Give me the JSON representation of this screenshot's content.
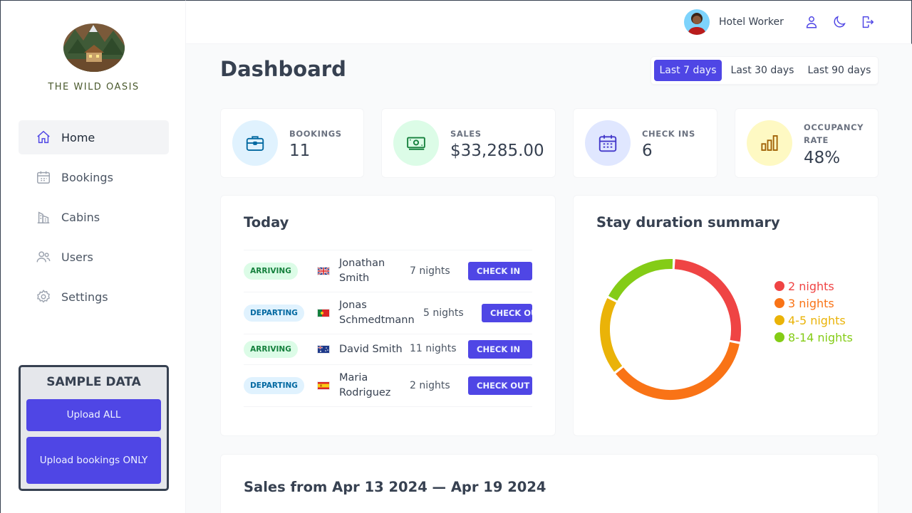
{
  "brand": {
    "name": "THE WILD OASIS"
  },
  "sidebar": {
    "items": [
      {
        "label": "Home",
        "icon": "home-icon",
        "active": true
      },
      {
        "label": "Bookings",
        "icon": "calendar-icon",
        "active": false
      },
      {
        "label": "Cabins",
        "icon": "buildings-icon",
        "active": false
      },
      {
        "label": "Users",
        "icon": "users-icon",
        "active": false
      },
      {
        "label": "Settings",
        "icon": "cog-icon",
        "active": false
      }
    ]
  },
  "sample_data": {
    "title": "SAMPLE DATA",
    "upload_all": "Upload ALL",
    "upload_bookings": "Upload bookings ONLY"
  },
  "header": {
    "user_name": "Hotel Worker",
    "icons": [
      "user-icon",
      "moon-icon",
      "logout-icon"
    ]
  },
  "page": {
    "title": "Dashboard"
  },
  "filter": {
    "options": [
      "Last 7 days",
      "Last 30 days",
      "Last 90 days"
    ],
    "selected": "Last 7 days"
  },
  "stats": [
    {
      "label": "BOOKINGS",
      "value": "11",
      "icon": "briefcase-icon",
      "bg": "#e0f2fe",
      "color": "#0369a1"
    },
    {
      "label": "SALES",
      "value": "$33,285.00",
      "icon": "banknotes-icon",
      "bg": "#dcfce7",
      "color": "#15803d"
    },
    {
      "label": "CHECK INS",
      "value": "6",
      "icon": "calendar-days-icon",
      "bg": "#e0e7ff",
      "color": "#4338ca"
    },
    {
      "label": "OCCUPANCY RATE",
      "value": "48%",
      "icon": "chart-bar-icon",
      "bg": "#fef9c3",
      "color": "#a16207"
    }
  ],
  "today": {
    "title": "Today",
    "rows": [
      {
        "status": "ARRIVING",
        "flag": "gb-flag-icon",
        "guest": "Jonathan Smith",
        "nights": "7 nights",
        "action": "CHECK IN"
      },
      {
        "status": "DEPARTING",
        "flag": "pt-flag-icon",
        "guest": "Jonas Schmedtmann",
        "nights": "5 nights",
        "action": "CHECK OUT"
      },
      {
        "status": "ARRIVING",
        "flag": "au-flag-icon",
        "guest": "David Smith",
        "nights": "11 nights",
        "action": "CHECK IN"
      },
      {
        "status": "DEPARTING",
        "flag": "es-flag-icon",
        "guest": "Maria Rodriguez",
        "nights": "2 nights",
        "action": "CHECK OUT"
      }
    ]
  },
  "stay_summary": {
    "title": "Stay duration summary"
  },
  "chart_data": {
    "type": "pie",
    "title": "Stay duration summary",
    "slices": [
      {
        "label": "2 nights",
        "value": 3,
        "color": "#ef4444"
      },
      {
        "label": "3 nights",
        "value": 4,
        "color": "#f97316"
      },
      {
        "label": "4-5 nights",
        "value": 2,
        "color": "#eab308"
      },
      {
        "label": "8-14 nights",
        "value": 2,
        "color": "#84cc16"
      }
    ],
    "legend": "right"
  },
  "sales": {
    "title": "Sales from Apr 13 2024 — Apr 19 2024"
  }
}
